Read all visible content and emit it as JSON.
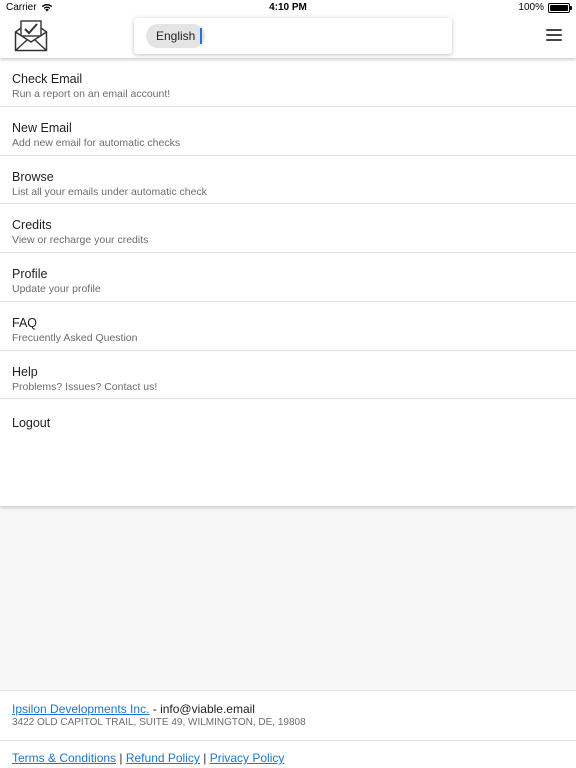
{
  "status_bar": {
    "carrier": "Carrier",
    "time": "4:10 PM",
    "battery": "100%",
    "battery_level": 1.0
  },
  "header": {
    "logo_icon": "envelope-check-icon",
    "language": "English",
    "search_value": "",
    "menu_icon": "hamburger-menu-icon"
  },
  "menu": {
    "items": [
      {
        "title": "Check Email",
        "subtitle": "Run a report on an email account!"
      },
      {
        "title": "New Email",
        "subtitle": "Add new email for automatic checks"
      },
      {
        "title": "Browse",
        "subtitle": "List all your emails under automatic check"
      },
      {
        "title": "Credits",
        "subtitle": "View or recharge your credits"
      },
      {
        "title": "Profile",
        "subtitle": "Update your profile"
      },
      {
        "title": "FAQ",
        "subtitle": "Frecuently Asked Question"
      },
      {
        "title": "Help",
        "subtitle": "Problems? Issues? Contact us!"
      },
      {
        "title": "Logout"
      }
    ]
  },
  "footer": {
    "company_link": "Ipsilon Developments Inc.",
    "company_separator": " - ",
    "email": "info@viable.email",
    "address": "3422 OLD CAPITOL TRAIL, SUITE 49, WILMINGTON, DE, 19808",
    "links": [
      "Terms & Conditions",
      "Refund Policy",
      "Privacy Policy"
    ],
    "link_separator": " | "
  },
  "colors": {
    "link": "#1976d2",
    "caret": "#1a73e8",
    "background": "#f6f6f6"
  }
}
